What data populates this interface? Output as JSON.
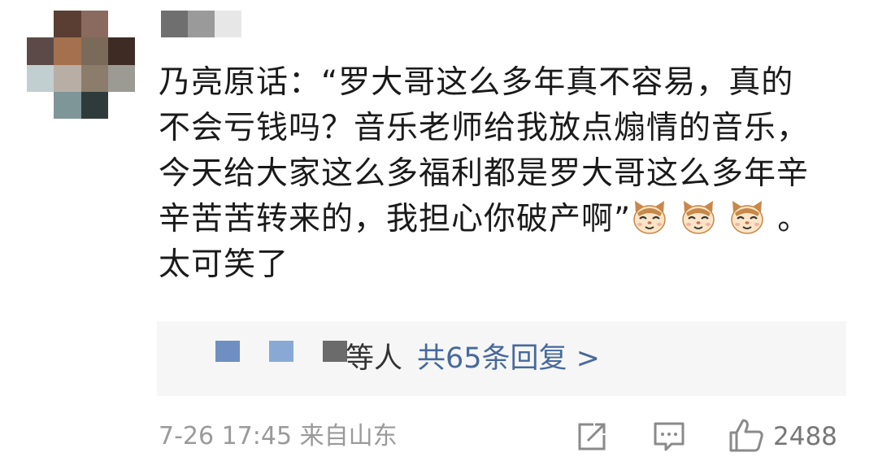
{
  "colors": {
    "link": "#47699c",
    "meta": "#9a9a9a",
    "text": "#1a1a1a",
    "reply_bg": "#f6f6f7"
  },
  "comment": {
    "line1": "乃亮原话：“罗大哥这么多年真不容易，真的",
    "line2": "不会亏钱吗？音乐老师给我放点煽情的音乐，",
    "line3": "今天给大家这么多福利都是罗大哥这么多年辛",
    "line4": "辛苦苦转来的，我担心你破产啊”",
    "line4_end": "。",
    "line5": "太可笑了",
    "emoji": "cat-face-icon"
  },
  "replies": {
    "suffix": "等人",
    "link": "共65条回复 >"
  },
  "meta": {
    "time": "7-26 17:45",
    "location": "来自山东"
  },
  "actions": {
    "like_count": "2488",
    "share_icon": "share-icon",
    "comment_icon": "comment-icon",
    "like_icon": "thumbs-up-icon"
  }
}
